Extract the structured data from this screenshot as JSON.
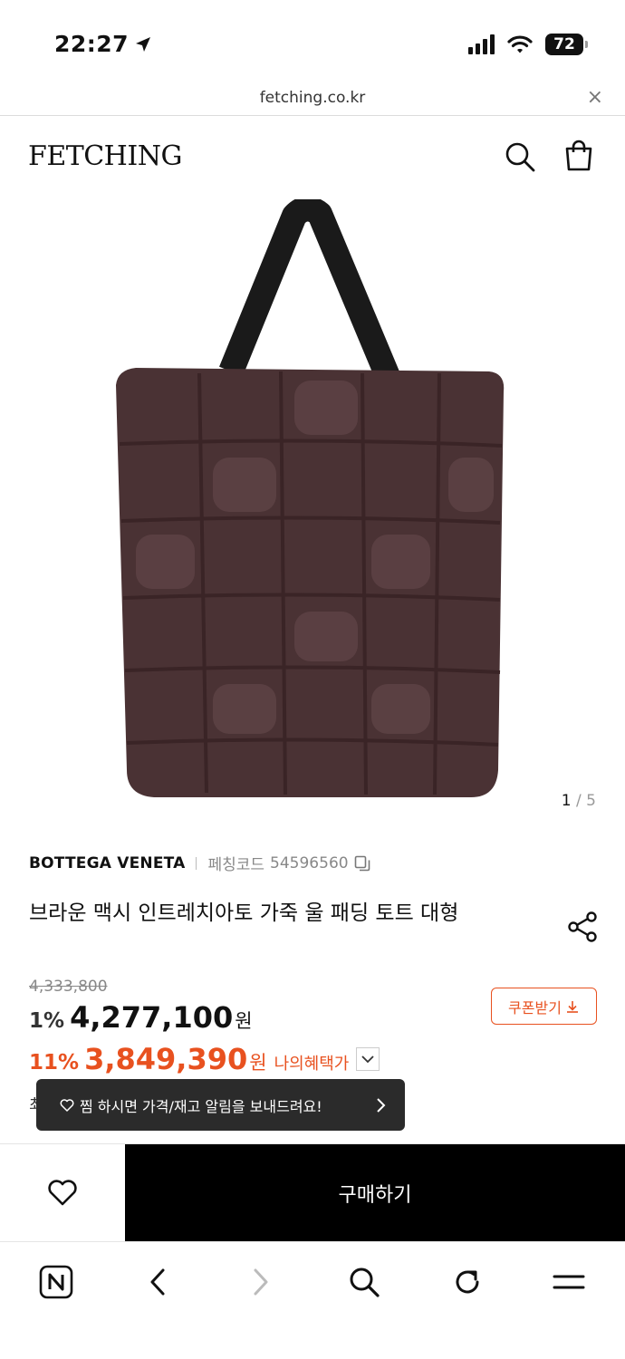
{
  "status_bar": {
    "time": "22:27",
    "battery": "72"
  },
  "browser": {
    "url": "fetching.co.kr",
    "close": "×"
  },
  "header": {
    "logo": "FETCHING"
  },
  "gallery": {
    "current": "1",
    "separator": "/",
    "total": "5"
  },
  "product": {
    "brand": "BOTTEGA VENETA",
    "code_label": "페칭코드",
    "code": "54596560",
    "title": "브라운 맥시 인트레치아토 가죽 울 패딩 토트 대형",
    "original_price": "4,333,800",
    "discount_pct": "1%",
    "price": "4,277,100",
    "currency": "원",
    "benefit_pct": "11%",
    "benefit_price": "3,849,390",
    "benefit_label": "나의혜택가"
  },
  "coupon": {
    "label": "쿠폰받기"
  },
  "partial": {
    "text": "최"
  },
  "toast": {
    "text": "찜 하시면 가격/재고 알림을 보내드려요!"
  },
  "actions": {
    "buy_label": "구매하기"
  },
  "colors": {
    "accent": "#e8511f",
    "bag": "#4a3234",
    "dark": "#000000"
  }
}
